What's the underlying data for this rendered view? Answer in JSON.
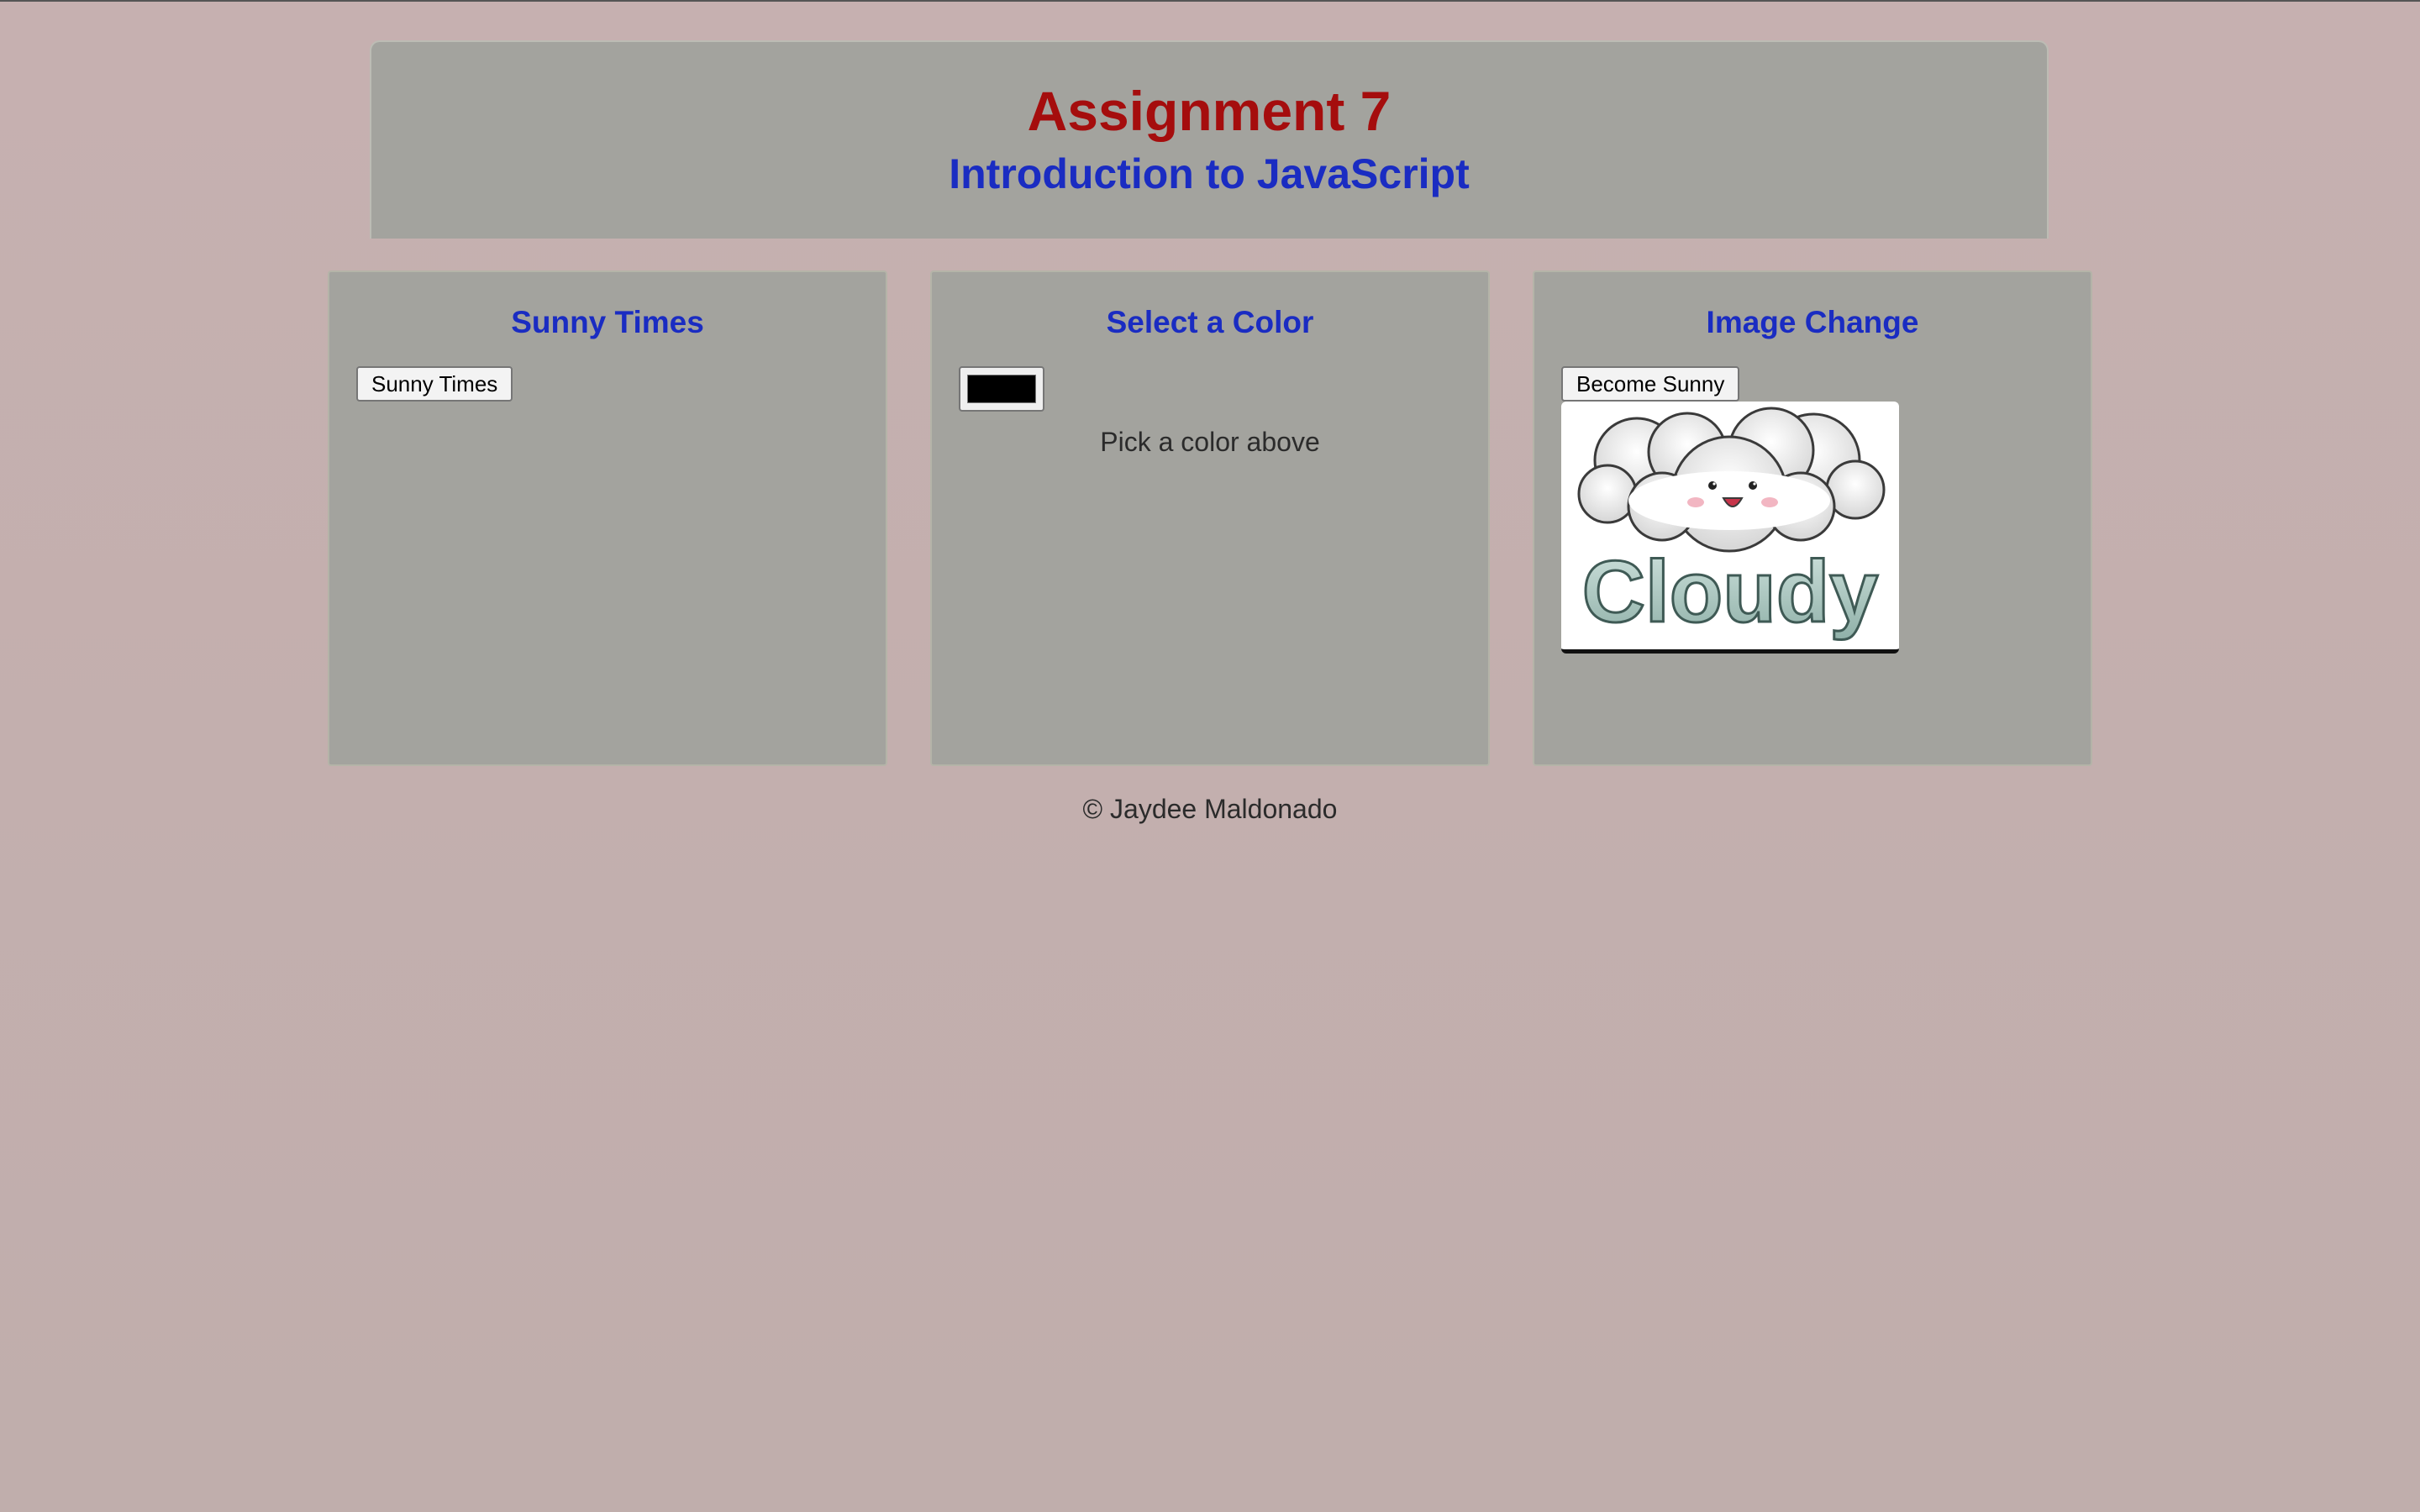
{
  "header": {
    "title": "Assignment 7",
    "subtitle": "Introduction to JavaScript"
  },
  "panels": {
    "sunny": {
      "heading": "Sunny Times",
      "button_label": "Sunny Times"
    },
    "color": {
      "heading": "Select a Color",
      "picker_value": "#000000",
      "message": "Pick a color above"
    },
    "image": {
      "heading": "Image Change",
      "button_label": "Become Sunny",
      "image_text": "Cloudy",
      "image_alt": "cloudy-cartoon-image"
    }
  },
  "footer": {
    "text": "© Jaydee Maldonado"
  },
  "colors": {
    "background": "#c4afaf",
    "panel": "#a3a39e",
    "title_red": "#a50d0d",
    "heading_blue": "#1a2cc2"
  }
}
